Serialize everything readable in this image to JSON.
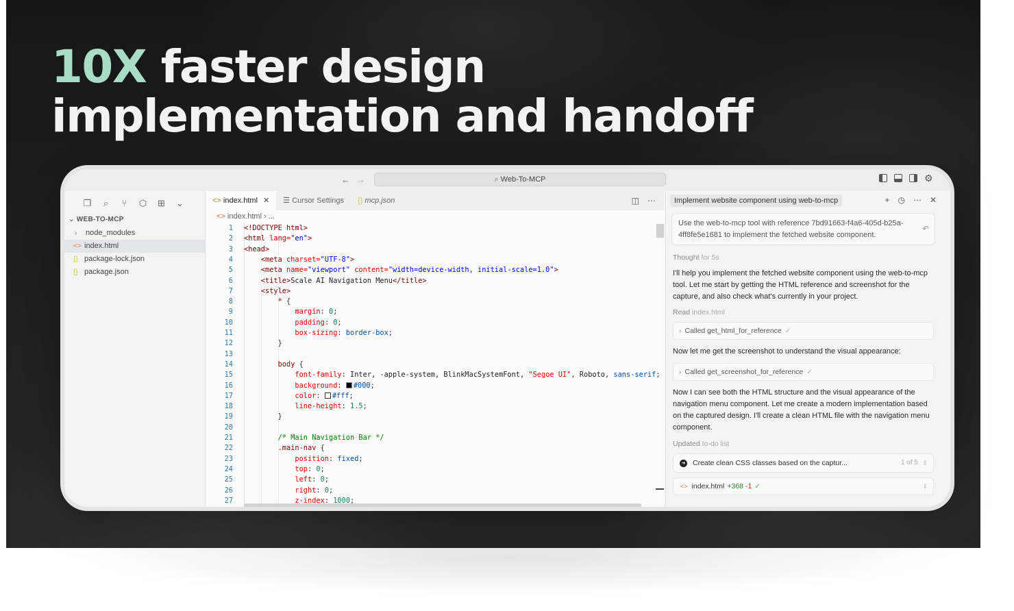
{
  "hero": {
    "accent_text": "10X",
    "line1_rest": " faster design",
    "line2": "implementation and handoff"
  },
  "colors": {
    "accent": "#a8dcc4",
    "background": "#1c1c1c"
  },
  "topbar": {
    "back_icon": "arrow-left-icon",
    "forward_icon": "arrow-right-icon",
    "command_center": "Web-To-MCP"
  },
  "sidebar": {
    "title": "WEB-TO-MCP",
    "items": [
      {
        "label": "node_modules",
        "type": "folder"
      },
      {
        "label": "index.html",
        "type": "html"
      },
      {
        "label": "package-lock.json",
        "type": "json"
      },
      {
        "label": "package.json",
        "type": "json"
      }
    ]
  },
  "editor": {
    "tabs": [
      {
        "label": "index.html"
      },
      {
        "label": "Cursor Settings"
      },
      {
        "label": "mcp.json"
      }
    ],
    "breadcrumb": "index.html",
    "breadcrumb_more": "...",
    "line_numbers": [
      "1",
      "2",
      "3",
      "4",
      "5",
      "6",
      "7",
      "8",
      "9",
      "10",
      "11",
      "12",
      "13",
      "14",
      "15",
      "16",
      "17",
      "18",
      "19",
      "20",
      "21",
      "22",
      "23",
      "24",
      "25",
      "26",
      "27"
    ],
    "code": {
      "l1_tag": "<!DOCTYPE html>",
      "l2_tag_open": "<html ",
      "l2_attr": "lang=",
      "l2_str": "\"en\"",
      "l2_tag_close": ">",
      "l3_tag": "<head>",
      "l4_tag_open": "<meta ",
      "l4_attr": "charset=",
      "l4_str": "\"UTF-8\"",
      "l4_tag_close": ">",
      "l5_tag_open": "<meta ",
      "l5_attr1": "name=",
      "l5_str1": "\"viewport\"",
      "l5_attr2": " content=",
      "l5_str2": "\"width=device-width, initial-scale=1.0\"",
      "l5_tag_close": ">",
      "l6_tag_open": "<title>",
      "l6_text": "Scale AI Navigation Menu",
      "l6_tag_close": "</title>",
      "l7_tag": "<style>",
      "l8_sel": "* ",
      "l8_brace": "{",
      "l9_prop": "margin",
      "l9_num": "0",
      "l10_prop": "padding",
      "l10_num": "0",
      "l11_prop": "box-sizing",
      "l11_val": "border-box",
      "l12_brace": "}",
      "l14_sel": "body ",
      "l14_brace": "{",
      "l15_prop": "font-family",
      "l15_val_a": "Inter, -apple-system, BlinkMacSystemFont, ",
      "l15_str": "\"Segoe UI\"",
      "l15_val_b": ", Roboto, ",
      "l15_val_c": "sans-serif",
      "l15_end": ";",
      "l16_prop": "background",
      "l16_val": "#000",
      "l17_prop": "color",
      "l17_val": "#fff",
      "l18_prop": "line-height",
      "l18_num": "1.5",
      "l19_brace": "}",
      "l21_comment": "/* Main Navigation Bar */",
      "l22_sel": ".main-nav ",
      "l22_brace": "{",
      "l23_prop": "position",
      "l23_val": "fixed",
      "l24_prop": "top",
      "l24_num": "0",
      "l25_prop": "left",
      "l25_num": "0",
      "l26_prop": "right",
      "l26_num": "0",
      "l27_prop": "z-index",
      "l27_num": "1000"
    }
  },
  "chat": {
    "title": "Implement website component using web-to-mcp",
    "prompt": "Use the web-to-mcp tool with reference 7bd91663-f4a6-405d-b25a-4ff8fe5e1681 to implement the fetched website component.",
    "thought_label": "Thought",
    "thought_time": "for 5s",
    "para1": "I'll help you implement the fetched website component using the web-to-mcp tool. Let me start by getting the HTML reference and screenshot for the capture, and also check what's currently in your project.",
    "read_label": "Read",
    "read_file": "index.html",
    "tool1": "Called get_html_for_reference",
    "para2": "Now let me get the screenshot to understand the visual appearance:",
    "tool2": "Called get_screenshot_for_reference",
    "para3": "Now I can see both the HTML structure and the visual appearance of the navigation menu component. Let me create a modern implementation based on the captured design. I'll create a clean HTML file with the navigation menu component.",
    "updated_label": "Updated",
    "updated_what": "to-do list",
    "todo_text": "Create clean CSS classes based on the captur...",
    "todo_count": "1 of 5",
    "file_name": "index.html",
    "file_added": "+368",
    "file_removed": "-1"
  }
}
